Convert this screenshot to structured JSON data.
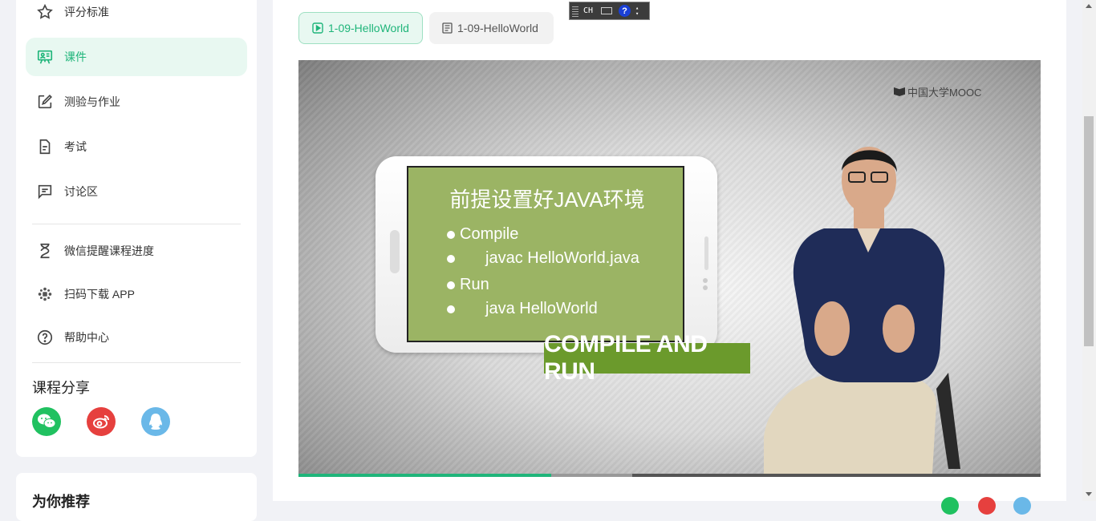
{
  "sidebar": {
    "items": [
      {
        "label": "评分标准",
        "icon": "star-icon"
      },
      {
        "label": "课件",
        "icon": "presentation-icon",
        "active": true
      },
      {
        "label": "测验与作业",
        "icon": "edit-icon"
      },
      {
        "label": "考试",
        "icon": "document-icon"
      },
      {
        "label": "讨论区",
        "icon": "comment-icon"
      }
    ],
    "tools": [
      {
        "label": "微信提醒课程进度",
        "icon": "hourglass-icon"
      },
      {
        "label": "扫码下载 APP",
        "icon": "app-download-icon"
      },
      {
        "label": "帮助中心",
        "icon": "help-icon"
      }
    ],
    "share_title": "课程分享",
    "share_icons": [
      "wechat-icon",
      "weibo-icon",
      "qq-icon"
    ],
    "recommend_title": "为你推荐"
  },
  "tabs": [
    {
      "label": "1-09-HelloWorld",
      "type": "video",
      "active": true
    },
    {
      "label": "1-09-HelloWorld",
      "type": "document",
      "active": false
    }
  ],
  "ime": {
    "label": "CH"
  },
  "video": {
    "watermark": "中国大学MOOC",
    "slide_title": "前提设置好JAVA环境",
    "bullets": [
      {
        "text": "Compile",
        "indent": false
      },
      {
        "text": "javac HelloWorld.java",
        "indent": true
      },
      {
        "text": "Run",
        "indent": false
      },
      {
        "text": "java HelloWorld",
        "indent": true
      }
    ],
    "banner": "COMPILE AND RUN",
    "progress_played": 0.34,
    "progress_buffered": 0.45
  },
  "colors": {
    "accent": "#1fb57a",
    "active_bg": "#e8f8f1",
    "wechat": "#20c160",
    "weibo": "#e6403e",
    "qq": "#6ab8e8",
    "slide_green": "#9bb464",
    "banner_green": "#6b9a2c"
  }
}
